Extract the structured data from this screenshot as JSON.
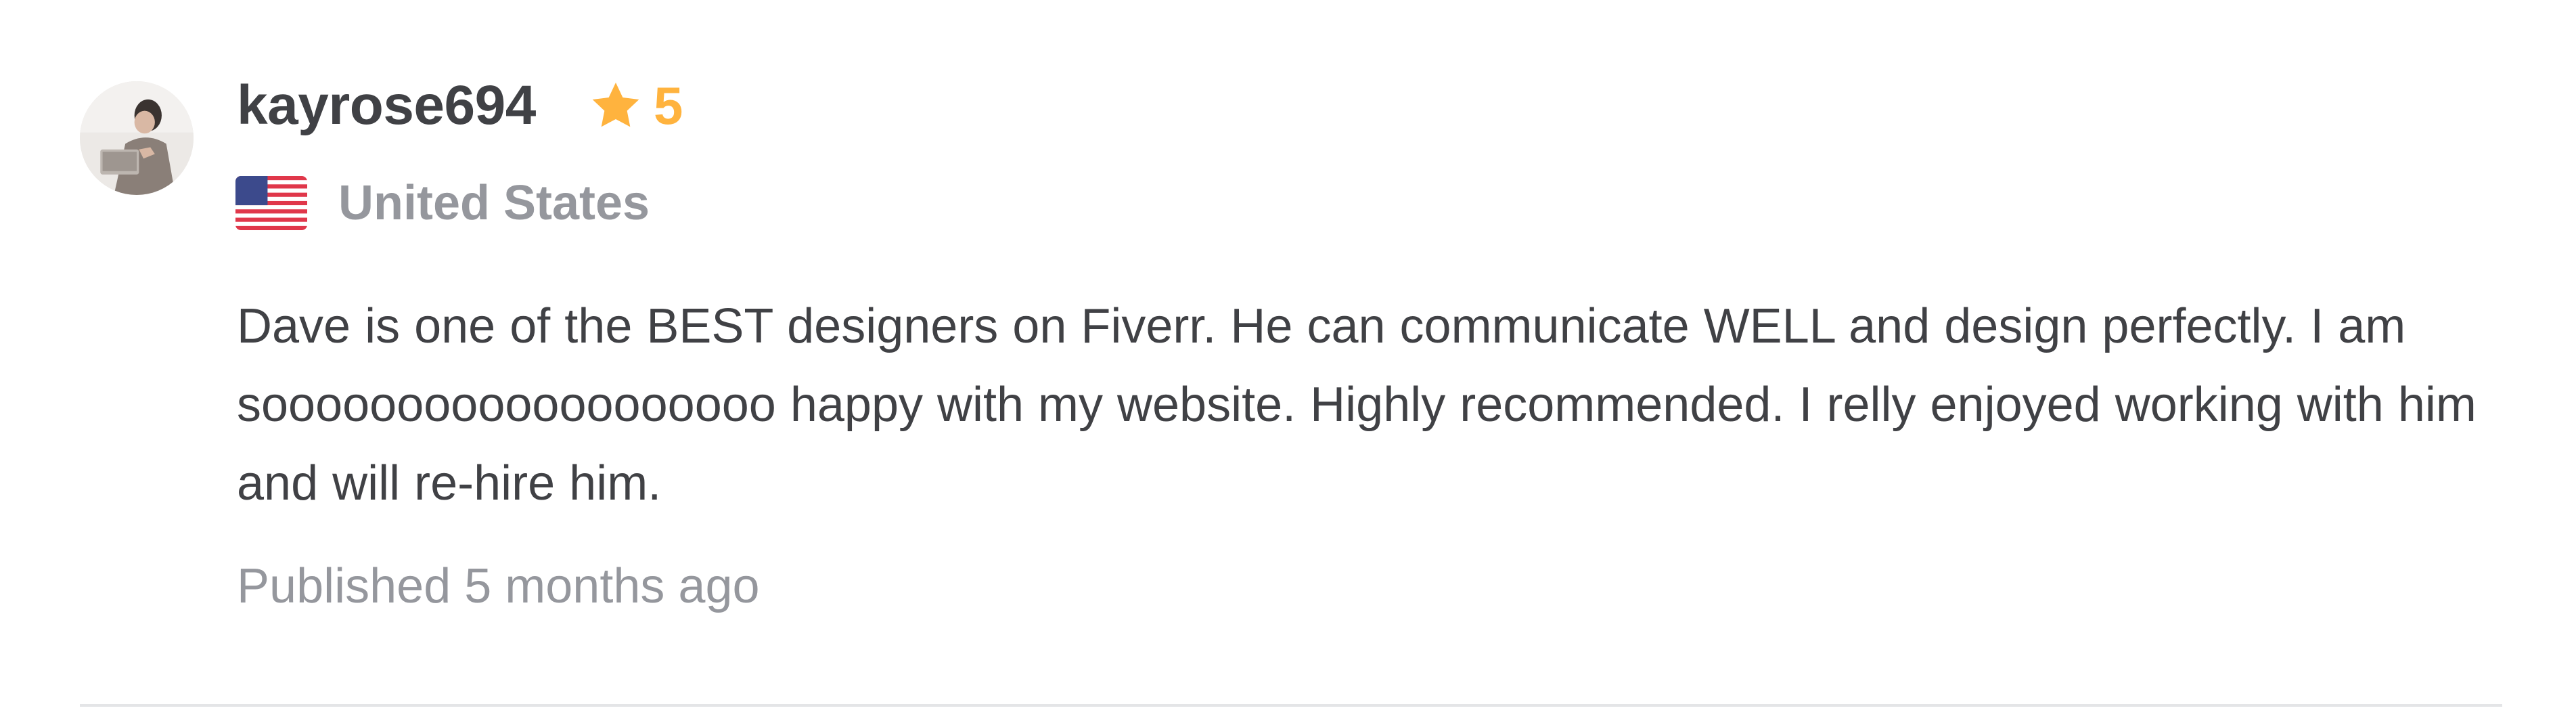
{
  "review": {
    "username": "kayrose694",
    "rating": "5",
    "country": "United States",
    "text": "Dave is one of the BEST designers on Fiverr. He can communicate WELL and design perfectly. I am sooooooooooooooooooo happy with my website. Highly recommended. I relly enjoyed working with him and will re-hire him.",
    "published": "Published 5 months ago",
    "icons": {
      "avatar": "user-avatar",
      "star": "star-icon",
      "flag": "us-flag-icon"
    }
  },
  "colors": {
    "star": "#ffb33e",
    "text": "#404145",
    "muted": "#95979d",
    "divider": "#e4e5e7"
  }
}
